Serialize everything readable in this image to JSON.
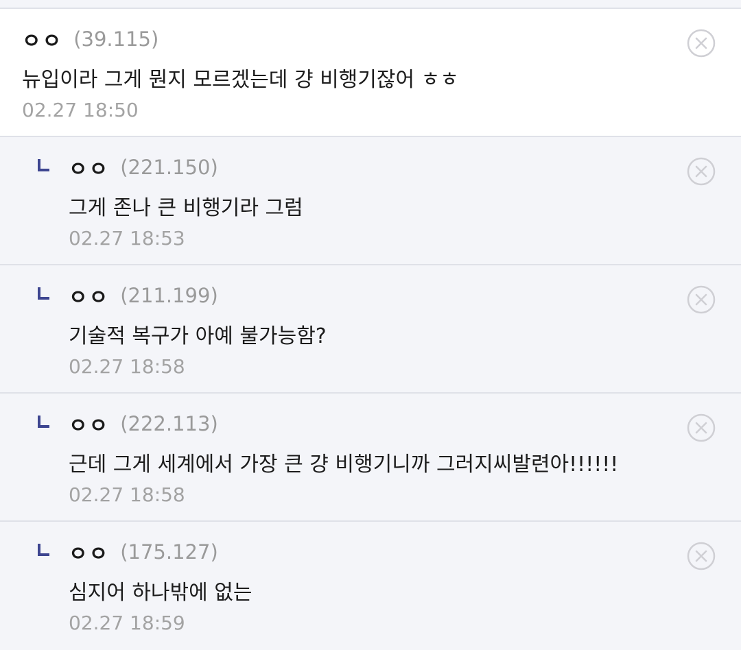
{
  "comments": [
    {
      "type": "main",
      "nickname": "ㅇㅇ",
      "ip": "(39.115)",
      "text": "뉴입이라 그게 뭔지 모르겠는데 걍 비행기잖어 ㅎㅎ",
      "date": "02.27 18:50",
      "delete_icon": "close-circle-icon"
    },
    {
      "type": "reply",
      "nickname": "ㅇㅇ",
      "ip": "(221.150)",
      "text": "그게 존나 큰 비행기라 그럼",
      "date": "02.27 18:53",
      "delete_icon": "close-circle-icon"
    },
    {
      "type": "reply",
      "nickname": "ㅇㅇ",
      "ip": "(211.199)",
      "text": "기술적 복구가 아예 불가능함?",
      "date": "02.27 18:58",
      "delete_icon": "close-circle-icon"
    },
    {
      "type": "reply",
      "nickname": "ㅇㅇ",
      "ip": "(222.113)",
      "text": "근데 그게 세계에서 가장 큰 걍 비행기니까 그러지씨발련아!!!!!!",
      "date": "02.27 18:58",
      "delete_icon": "close-circle-icon"
    },
    {
      "type": "reply",
      "nickname": "ㅇㅇ",
      "ip": "(175.127)",
      "text": "심지어 하나밖에 없는",
      "date": "02.27 18:59",
      "delete_icon": "close-circle-icon"
    }
  ],
  "colors": {
    "reply_background": "#f4f5f9",
    "reply_marker": "#3d4590",
    "ip_text": "#9a9a9a",
    "date_text": "#a3a3a3",
    "divider": "#dfe1e8",
    "delete_icon": "#cfcfd4"
  }
}
